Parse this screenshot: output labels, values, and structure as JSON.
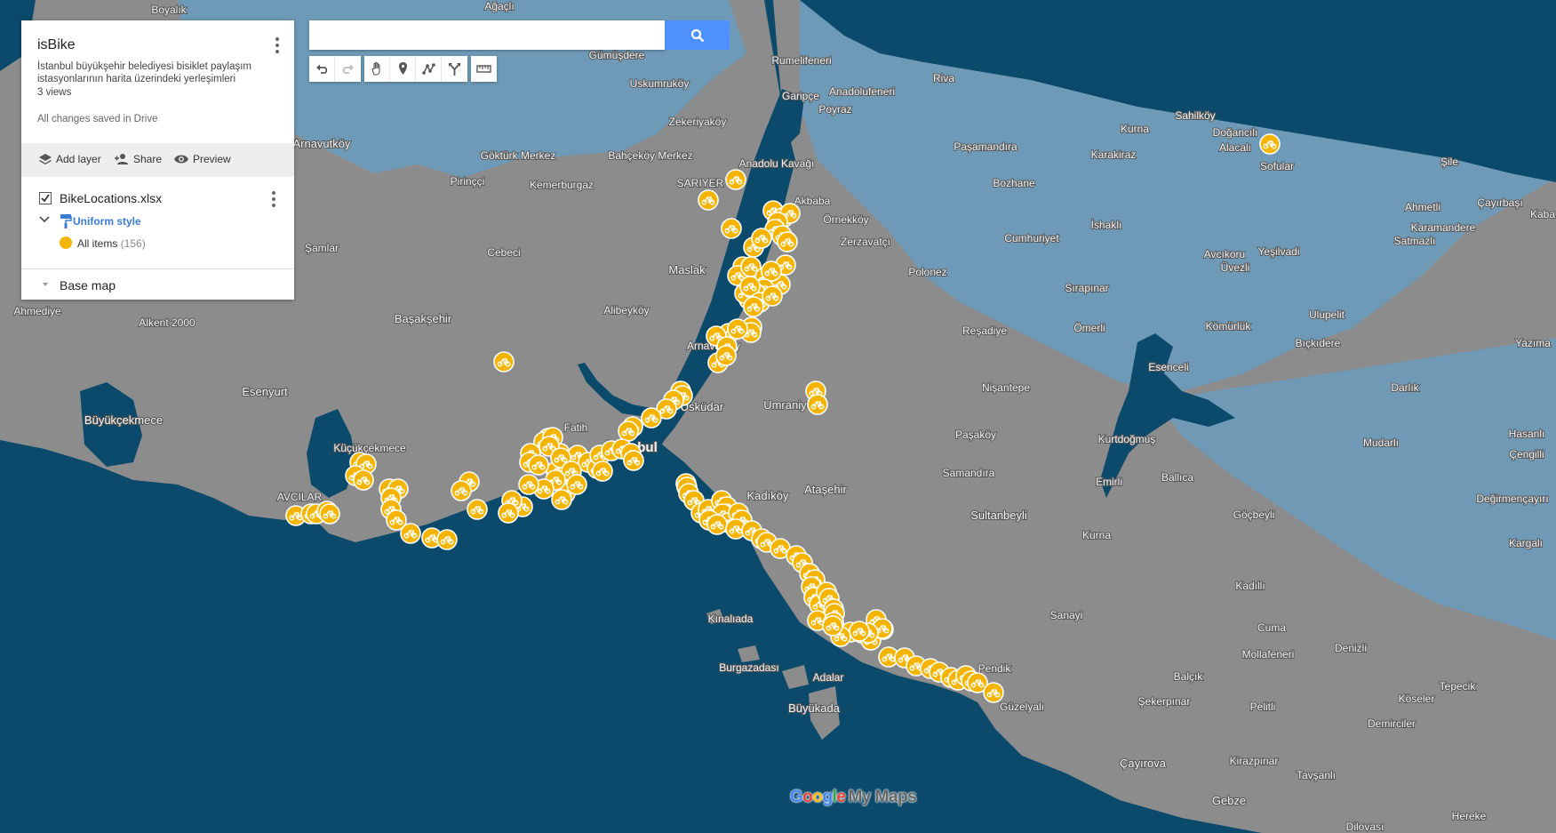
{
  "map": {
    "labels": [
      {
        "id": "boyalik",
        "text": "Boyalık"
      },
      {
        "id": "agacli",
        "text": "Ağaçlı"
      },
      {
        "id": "gumusdere",
        "text": "Gümüşdere"
      },
      {
        "id": "rumelifeneri",
        "text": "Rumelifeneri"
      },
      {
        "id": "uskumrukoy",
        "text": "Uskumruköy"
      },
      {
        "id": "garipce",
        "text": "Garipçe"
      },
      {
        "id": "anadolufeneri",
        "text": "Anadolufeneri"
      },
      {
        "id": "riva",
        "text": "Riva"
      },
      {
        "id": "poyraz",
        "text": "Poyraz"
      },
      {
        "id": "zekeriyakoy",
        "text": "Zekeriyaköy"
      },
      {
        "id": "arnavutkoy",
        "text": "Arnavutköy"
      },
      {
        "id": "gokturk",
        "text": "Göktürk Merkez"
      },
      {
        "id": "bahcekoy",
        "text": "Bahçeköy Merkez"
      },
      {
        "id": "anadolukavagi",
        "text": "Anadolu Kavağı"
      },
      {
        "id": "pasamandira",
        "text": "Paşamandıra"
      },
      {
        "id": "kurna1",
        "text": "Kurna"
      },
      {
        "id": "karakiraz",
        "text": "Karakiraz"
      },
      {
        "id": "sahilkoy",
        "text": "Sahilköy"
      },
      {
        "id": "dogancili",
        "text": "Doğancılı"
      },
      {
        "id": "alacali",
        "text": "Alacalı"
      },
      {
        "id": "sile",
        "text": "Şile"
      },
      {
        "id": "sofular",
        "text": "Sofular"
      },
      {
        "id": "pirinçci",
        "text": "Pirinççi"
      },
      {
        "id": "kemerburgaz",
        "text": "Kemerburgaz"
      },
      {
        "id": "sariyer",
        "text": "SARIYER"
      },
      {
        "id": "akbaba",
        "text": "Akbaba"
      },
      {
        "id": "bozhane",
        "text": "Bozhane"
      },
      {
        "id": "ahmetli",
        "text": "Ahmetli"
      },
      {
        "id": "cayirbasi",
        "text": "Çayırbaşı"
      },
      {
        "id": "kaba",
        "text": "Kaba"
      },
      {
        "id": "ornekkoy",
        "text": "Örnekköy"
      },
      {
        "id": "ishakli",
        "text": "İshaklı"
      },
      {
        "id": "karamandere",
        "text": "Karamandere"
      },
      {
        "id": "zerzavatci",
        "text": "Zerzavatçı"
      },
      {
        "id": "cumhuriyet",
        "text": "Cumhuriyet"
      },
      {
        "id": "satmazli",
        "text": "Satmazlı"
      },
      {
        "id": "samlar",
        "text": "Şamlar"
      },
      {
        "id": "cebeci",
        "text": "Cebeci"
      },
      {
        "id": "maslak",
        "text": "Maslak"
      },
      {
        "id": "avcikoru",
        "text": "Avcıkoru"
      },
      {
        "id": "yesilvadi",
        "text": "Yeşilvadi"
      },
      {
        "id": "uvezli",
        "text": "Üvezli"
      },
      {
        "id": "polonez",
        "text": "Polonez"
      },
      {
        "id": "sirapinar",
        "text": "Sırapınar"
      },
      {
        "id": "ahmediye",
        "text": "Ahmediye"
      },
      {
        "id": "alkent",
        "text": "Alkent 2000"
      },
      {
        "id": "alibeykoy",
        "text": "Alibeyköy"
      },
      {
        "id": "ulupelit",
        "text": "Ulupelit"
      },
      {
        "id": "basaksehir",
        "text": "Başakşehir"
      },
      {
        "id": "resadiye",
        "text": "Reşadiye"
      },
      {
        "id": "omerli",
        "text": "Ömerli"
      },
      {
        "id": "komurluk",
        "text": "Kömürlük"
      },
      {
        "id": "bickidere",
        "text": "Bıçkıdere"
      },
      {
        "id": "yazima",
        "text": "Yazıma"
      },
      {
        "id": "arnavutkoy2",
        "text": "Arnavutköy"
      },
      {
        "id": "esenceli",
        "text": "Esenceli"
      },
      {
        "id": "esenyurt",
        "text": "Esenyurt"
      },
      {
        "id": "nisantepe",
        "text": "Nişantepe"
      },
      {
        "id": "darlik",
        "text": "Darlık"
      },
      {
        "id": "umraniye",
        "text": "Umraniye"
      },
      {
        "id": "uskudar",
        "text": "Üsküdar"
      },
      {
        "id": "buyukcekmece",
        "text": "Büyükçekmece"
      },
      {
        "id": "fatih",
        "text": "Fatih"
      },
      {
        "id": "pasakoy",
        "text": "Paşaköy"
      },
      {
        "id": "kurtdogmus",
        "text": "Kurtdoğmuş"
      },
      {
        "id": "hasanli",
        "text": "Hasanlı"
      },
      {
        "id": "istanbul",
        "text": "İstanbul"
      },
      {
        "id": "kucukcekmece",
        "text": "Küçükçekmece"
      },
      {
        "id": "mudarli",
        "text": "Mudarlı"
      },
      {
        "id": "cengilli",
        "text": "Çengilli"
      },
      {
        "id": "samandira",
        "text": "Samandıra"
      },
      {
        "id": "emirli",
        "text": "Emirli"
      },
      {
        "id": "ballica",
        "text": "Ballıca"
      },
      {
        "id": "atasehir",
        "text": "Ataşehir"
      },
      {
        "id": "kadikoy",
        "text": "Kadıköy"
      },
      {
        "id": "avcilar",
        "text": "AVCILAR"
      },
      {
        "id": "degirmencayiri",
        "text": "Değirmençayırı"
      },
      {
        "id": "sultanbeyli",
        "text": "Sultanbeyli"
      },
      {
        "id": "gocbeyli",
        "text": "Göçbeyli"
      },
      {
        "id": "kurna2",
        "text": "Kurna"
      },
      {
        "id": "kargali",
        "text": "Kargalı"
      },
      {
        "id": "kadilli",
        "text": "Kadıllı"
      },
      {
        "id": "sanayi",
        "text": "Sanayi"
      },
      {
        "id": "kinaliada",
        "text": "Kınalıada"
      },
      {
        "id": "cuma",
        "text": "Cuma"
      },
      {
        "id": "denizli",
        "text": "Denizli"
      },
      {
        "id": "mollafeneri",
        "text": "Mollafeneri"
      },
      {
        "id": "pendik",
        "text": "Pendik"
      },
      {
        "id": "burgazadasi",
        "text": "Burgazadası"
      },
      {
        "id": "adalar",
        "text": "Adalar"
      },
      {
        "id": "balcik",
        "text": "Balçık"
      },
      {
        "id": "tepecik",
        "text": "Tepecik"
      },
      {
        "id": "guzelyali",
        "text": "Güzelyalı"
      },
      {
        "id": "sekerpinar",
        "text": "Şekerpınar"
      },
      {
        "id": "pelitli",
        "text": "Pelitli"
      },
      {
        "id": "koseler",
        "text": "Köseler"
      },
      {
        "id": "buyukada",
        "text": "Büyükada"
      },
      {
        "id": "demirciler",
        "text": "Demirciler"
      },
      {
        "id": "cayirova",
        "text": "Çayırova"
      },
      {
        "id": "kirazpinar",
        "text": "Kirazpınar"
      },
      {
        "id": "tavsanli",
        "text": "Tavşanlı"
      },
      {
        "id": "gebze",
        "text": "Gebze"
      },
      {
        "id": "hereke",
        "text": "Hereke"
      },
      {
        "id": "dilovasi",
        "text": "Dilovası"
      },
      {
        "id": "akbaba2",
        "text": "Akbaba"
      }
    ]
  },
  "panel": {
    "title": "isBike",
    "description": "İstanbul büyükşehir belediyesi bisiklet paylaşım istasyonlarının harita üzerindeki yerleşimleri",
    "views": "3 views",
    "saved": "All changes saved in Drive",
    "actions": {
      "add_layer": "Add layer",
      "share": "Share",
      "preview": "Preview"
    },
    "layer": {
      "name": "BikeLocations.xlsx",
      "checked": true,
      "style": "Uniform style",
      "items_label": "All items",
      "items_count": "(156)"
    },
    "base_map": "Base map"
  },
  "search": {
    "value": "",
    "placeholder": ""
  },
  "toolbar": {
    "tools": [
      "undo-icon",
      "redo-icon",
      "hand-icon",
      "marker-icon",
      "draw-line-icon",
      "directions-icon",
      "ruler-icon"
    ]
  },
  "logo": {
    "google": "Google",
    "product": "My Maps"
  },
  "colors": {
    "water": "#0b4a6b",
    "land_gray": "#8a8a8a",
    "land_blue": "#6294b4",
    "marker": "#f5b400",
    "search_button": "#4d90fe"
  }
}
